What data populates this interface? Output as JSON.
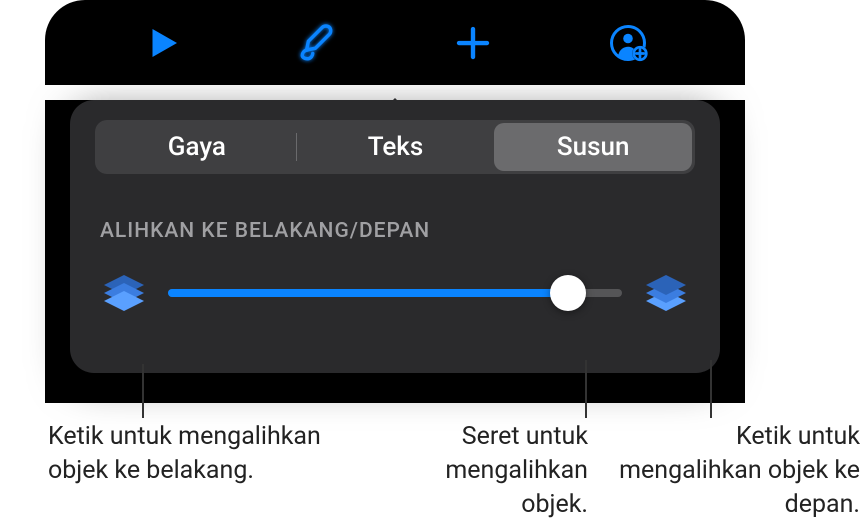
{
  "toolbar": {
    "play_icon": "play",
    "format_icon": "paintbrush",
    "add_icon": "plus",
    "collaborate_icon": "person-add"
  },
  "tabs": {
    "style": "Gaya",
    "text": "Teks",
    "arrange": "Susun"
  },
  "section": {
    "move_back_front_label": "ALIHKAN KE BELAKANG/DEPAN"
  },
  "slider": {
    "value_percent": 88
  },
  "callouts": {
    "back_button": "Ketik untuk mengalihkan objek ke belakang.",
    "drag_slider": "Seret untuk mengalihkan objek.",
    "front_button": "Ketik untuk mengalihkan objek ke depan."
  }
}
